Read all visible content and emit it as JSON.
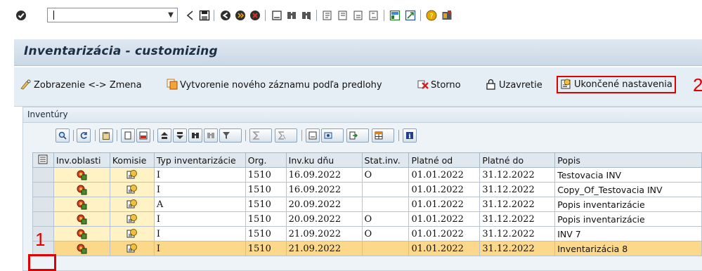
{
  "toolbar": {
    "command_value": "",
    "icons": [
      "enter-icon",
      "back-icon",
      "save-icon",
      "green-back-icon",
      "exit-icon",
      "cancel-icon",
      "print-icon",
      "find-icon",
      "find-next-icon",
      "first-page-icon",
      "previous-page-icon",
      "next-page-icon",
      "last-page-icon",
      "new-session-icon",
      "shortcut-icon",
      "help-icon",
      "layout-icon"
    ]
  },
  "title": "Inventarizácia - customizing",
  "app_toolbar": {
    "display_change": "Zobrazenie <-> Zmena",
    "new_from_template": "Vytvorenie nového záznamu podľa predlohy",
    "cancel": "Storno",
    "close": "Uzavretie",
    "finished_settings": "Ukončené nastavenia"
  },
  "callouts": {
    "one": "1",
    "two": "2"
  },
  "panel": {
    "title": "Inventúry"
  },
  "table": {
    "columns": [
      "Inv.oblasti",
      "Komisie",
      "Typ inventarizácie",
      "Org.",
      "Inv.ku dňu",
      "Stat.inv.",
      "Platné od",
      "Platné do",
      "Popis"
    ],
    "rows": [
      {
        "typ": "I",
        "org": "1510",
        "inv_ku_dnu": "16.09.2022",
        "stat": "O",
        "platne_od": "01.01.2022",
        "platne_do": "31.12.2022",
        "popis": "Testovacia INV"
      },
      {
        "typ": "I",
        "org": "1510",
        "inv_ku_dnu": "16.09.2022",
        "stat": "",
        "platne_od": "01.01.2022",
        "platne_do": "31.12.2022",
        "popis": "Copy_Of_Testovacia INV"
      },
      {
        "typ": "A",
        "org": "1510",
        "inv_ku_dnu": "20.09.2022",
        "stat": "",
        "platne_od": "01.01.2022",
        "platne_do": "31.12.2022",
        "popis": "Popis inventarizácie"
      },
      {
        "typ": "I",
        "org": "1510",
        "inv_ku_dnu": "20.09.2022",
        "stat": "O",
        "platne_od": "01.01.2022",
        "platne_do": "31.12.2022",
        "popis": "Popis inventarizácie"
      },
      {
        "typ": "I",
        "org": "1510",
        "inv_ku_dnu": "21.09.2022",
        "stat": "O",
        "platne_od": "01.01.2022",
        "platne_do": "31.12.2022",
        "popis": "INV 7"
      },
      {
        "typ": "I",
        "org": "1510",
        "inv_ku_dnu": "21.09.2022",
        "stat": "",
        "platne_od": "01.01.2022",
        "platne_do": "31.12.2022",
        "popis": "Inventarizácia 8"
      }
    ],
    "highlighted_row": 6
  },
  "colors": {
    "highlight_row": "#fcd88a",
    "callout_red": "#e00000",
    "header_bg": "#dfe7ef",
    "title_bar": "#cad8e6"
  }
}
